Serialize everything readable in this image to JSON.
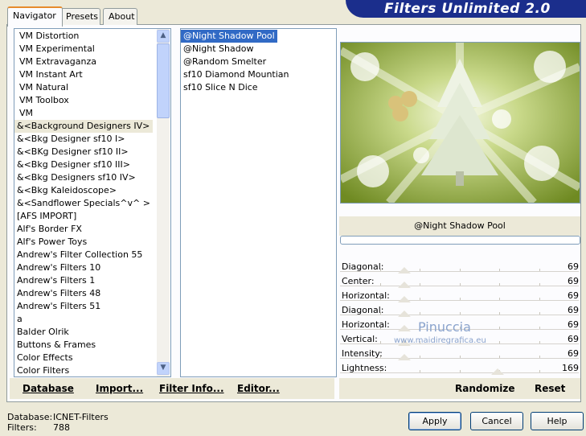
{
  "banner": {
    "title": "Filters Unlimited 2.0"
  },
  "tabs": [
    {
      "label": "Navigator"
    },
    {
      "label": "Presets"
    },
    {
      "label": "About"
    }
  ],
  "categories": {
    "items": [
      "VM Distortion",
      "VM Experimental",
      "VM Extravaganza",
      "VM Instant Art",
      "VM Natural",
      "VM Toolbox",
      "VM",
      "&<Background Designers IV>",
      "&<Bkg Designer sf10 I>",
      "&<BKg Designer sf10 II>",
      "&<Bkg Designer sf10 III>",
      "&<Bkg Designers sf10 IV>",
      "&<Bkg Kaleidoscope>",
      "&<Sandflower Specials^v^ >",
      "[AFS IMPORT]",
      "Alf's Border FX",
      "Alf's Power Toys",
      "Andrew's Filter Collection 55",
      "Andrew's Filters 10",
      "Andrew's Filters 1",
      "Andrew's Filters 48",
      "Andrew's Filters 51",
      "a",
      "Balder Olrik",
      "Buttons & Frames",
      "Color Effects",
      "Color Filters"
    ],
    "selected_index": 7
  },
  "filters": {
    "items": [
      "@Night Shadow Pool",
      "@Night Shadow",
      "@Random Smelter",
      "sf10 Diamond Mountian",
      "sf10 Slice N Dice"
    ],
    "selected_index": 0
  },
  "preview": {
    "filter_name": "@Night Shadow Pool"
  },
  "sliders": [
    {
      "label": "Diagonal:",
      "value": "69"
    },
    {
      "label": "Center:",
      "value": "69"
    },
    {
      "label": "Horizontal:",
      "value": "69"
    },
    {
      "label": "Diagonal:",
      "value": "69"
    },
    {
      "label": "Horizontal:",
      "value": "69"
    },
    {
      "label": "Vertical:",
      "value": "69"
    },
    {
      "label": "Intensity:",
      "value": "69"
    },
    {
      "label": "Lightness:",
      "value": "169"
    }
  ],
  "slider_fraction": [
    0.27,
    0.27,
    0.27,
    0.27,
    0.27,
    0.27,
    0.27,
    0.66
  ],
  "watermark": {
    "name": "Pinuccia",
    "url": "www.maidiregrafica.eu"
  },
  "toolbar": {
    "database": "Database",
    "import": "Import...",
    "filter_info": "Filter Info...",
    "editor": "Editor...",
    "randomize": "Randomize",
    "reset": "Reset"
  },
  "status": {
    "database_label": "Database:",
    "database_value": "ICNET-Filters",
    "filters_label": "Filters:",
    "filters_value": "788"
  },
  "buttons": {
    "apply": "Apply",
    "cancel": "Cancel",
    "help": "Help"
  }
}
